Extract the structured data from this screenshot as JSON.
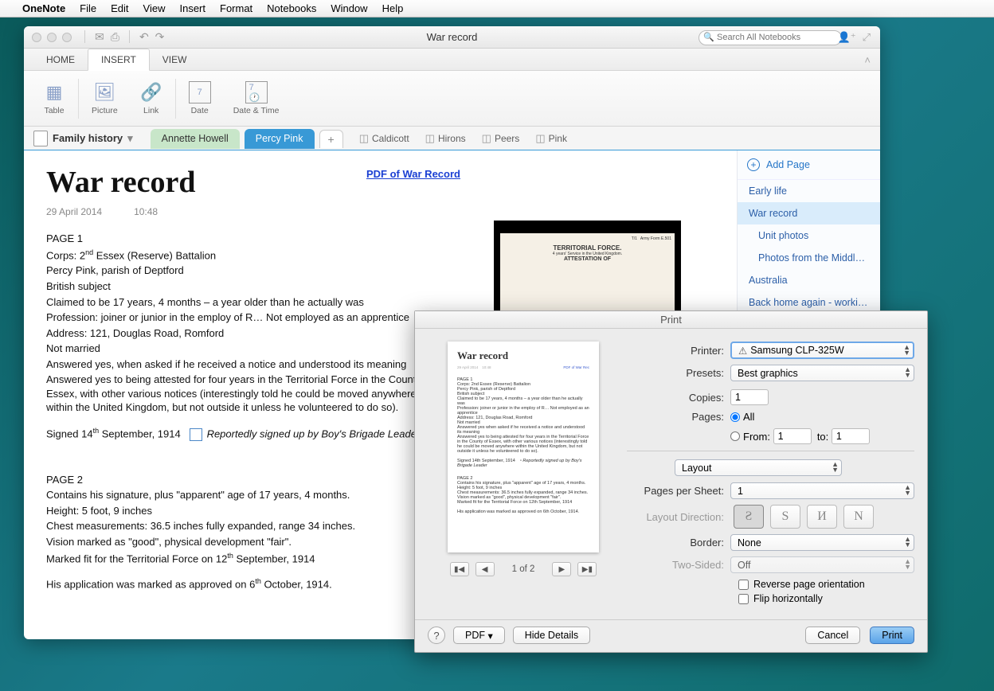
{
  "menubar": {
    "app": "OneNote",
    "items": [
      "File",
      "Edit",
      "View",
      "Insert",
      "Format",
      "Notebooks",
      "Window",
      "Help"
    ]
  },
  "window": {
    "title": "War record",
    "search_placeholder": "Search All Notebooks",
    "tabs": {
      "home": "HOME",
      "insert": "INSERT",
      "view": "VIEW"
    },
    "ribbon": {
      "table": "Table",
      "picture": "Picture",
      "link": "Link",
      "date": "Date",
      "datetime": "Date & Time"
    }
  },
  "notebook": "Family history",
  "sections": {
    "s1": "Annette Howell",
    "s2": "Percy Pink"
  },
  "quick": [
    "Caldicott",
    "Hirons",
    "Peers",
    "Pink"
  ],
  "page": {
    "title": "War record",
    "date": "29 April 2014",
    "time": "10:48",
    "pdf_link": "PDF of War Record",
    "lines": {
      "p1": "PAGE 1",
      "l1": "Corps: 2",
      "l1sup": "nd",
      "l1b": " Essex (Reserve) Battalion",
      "l2": "Percy Pink, parish of Deptford",
      "l3": "British subject",
      "l4": "Claimed to be 17 years, 4 months – a year older than he actually was",
      "l5": "Profession: joiner or junior in the employ of R… Not employed as an apprentice",
      "l6": "Address: 121, Douglas Road, Romford",
      "l7": "Not married",
      "l8": "Answered yes, when asked if he received a notice and understood its meaning",
      "l9": "Answered yes to being attested for four years in the Territorial Force in the County of Essex, with other various notices (interestingly told he could be moved anywhere within the United Kingdom, but not outside it unless he volunteered to do so).",
      "sgn1a": "Signed 14",
      "sgn1sup": "th",
      "sgn1b": " September, 1914",
      "rep": "Reportedly signed up by Boy's Brigade Leader",
      "p2": "PAGE 2",
      "l10": "Contains his signature, plus \"apparent\" age of 17 years, 4 months.",
      "l11": "Height: 5 foot, 9 inches",
      "l12": "Chest measurements: 36.5 inches fully expanded, range 34 inches.",
      "l13": "Vision marked as \"good\", physical development \"fair\".",
      "l14a": "Marked fit for the Territorial Force on 12",
      "l14sup": "th",
      "l14b": " September, 1914",
      "l15a": "His application was marked as approved on 6",
      "l15sup": "th",
      "l15b": " October, 1914."
    }
  },
  "sidebar": {
    "add": "Add Page",
    "items": [
      "Early life",
      "War record",
      "Unit photos",
      "Photos from the Middle…",
      "Australia",
      "Back home again - worki…"
    ]
  },
  "print": {
    "title": "Print",
    "labels": {
      "printer": "Printer:",
      "presets": "Presets:",
      "copies": "Copies:",
      "pages": "Pages:",
      "all": "All",
      "from": "From:",
      "to": "to:",
      "layout": "Layout",
      "pps": "Pages per Sheet:",
      "ldir": "Layout Direction:",
      "border": "Border:",
      "twosided": "Two-Sided:",
      "rev": "Reverse page orientation",
      "flip": "Flip horizontally"
    },
    "values": {
      "printer": "Samsung CLP-325W",
      "presets": "Best graphics",
      "copies": "1",
      "from": "1",
      "to": "1",
      "pps": "1",
      "border": "None",
      "twosided": "Off"
    },
    "nav": "1 of 2",
    "buttons": {
      "help": "?",
      "pdf": "PDF",
      "hide": "Hide Details",
      "cancel": "Cancel",
      "print": "Print"
    }
  }
}
